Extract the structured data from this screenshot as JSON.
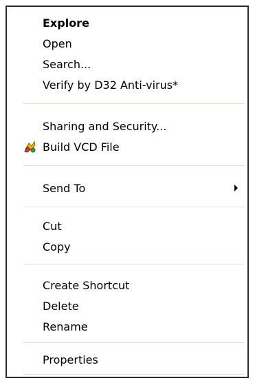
{
  "menu": {
    "items": [
      {
        "label": "Explore"
      },
      {
        "label": "Open"
      },
      {
        "label": "Search..."
      },
      {
        "label": "Verify by D32 Anti-virus*"
      },
      {
        "label": "Sharing and Security..."
      },
      {
        "label": "Build VCD File",
        "icon": "vcd-build-icon"
      },
      {
        "label": "Send To",
        "icon": "submenu-arrow-icon"
      },
      {
        "label": "Cut"
      },
      {
        "label": "Copy"
      },
      {
        "label": "Create Shortcut"
      },
      {
        "label": "Delete"
      },
      {
        "label": "Rename"
      },
      {
        "label": "Properties"
      }
    ],
    "colors": {
      "border": "#2b2b2b",
      "separator": "#e8dfc9",
      "text": "#000000",
      "background": "#ffffff"
    }
  }
}
